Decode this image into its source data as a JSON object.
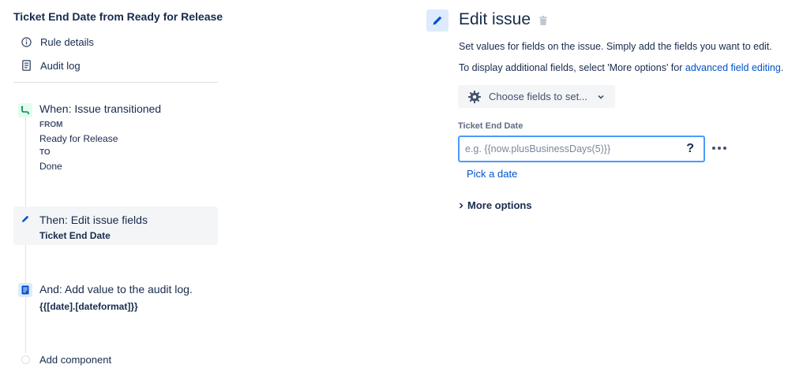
{
  "rule": {
    "title": "Ticket End Date from Ready for Release",
    "nav": [
      {
        "label": "Rule details",
        "icon": "info-icon"
      },
      {
        "label": "Audit log",
        "icon": "document-icon"
      }
    ]
  },
  "steps": {
    "trigger": {
      "title": "When: Issue transitioned",
      "from_label": "FROM",
      "from_value": "Ready for Release",
      "to_label": "TO",
      "to_value": "Done",
      "icon": "transition-icon"
    },
    "action": {
      "title": "Then: Edit issue fields",
      "detail": "Ticket End Date",
      "icon": "pencil-icon"
    },
    "audit": {
      "title": "And: Add value to the audit log.",
      "detail": "{{[date].[dateformat]}}",
      "icon": "document-icon"
    },
    "add_component": "Add component"
  },
  "editor": {
    "title": "Edit issue",
    "desc1": "Set values for fields on the issue. Simply add the fields you want to edit.",
    "desc2_prefix": "To display additional fields, select 'More options' for ",
    "desc2_link": "advanced field editing",
    "desc2_suffix": ".",
    "choose_fields": "Choose fields to set...",
    "field_label": "Ticket End Date",
    "field_placeholder": "e.g. {{now.plusBusinessDays(5)}}",
    "field_value": "",
    "help": "?",
    "pick_date": "Pick a date",
    "more_options": "More options"
  },
  "colors": {
    "text": "#172b4d",
    "link": "#0052cc",
    "trigger_icon_bg": "#e3fcef",
    "trigger_icon_fg": "#00875a",
    "action_icon_bg": "#deebff",
    "action_icon_fg": "#0052cc",
    "selected_bg": "#f4f5f7",
    "input_border": "#4c9aff"
  }
}
